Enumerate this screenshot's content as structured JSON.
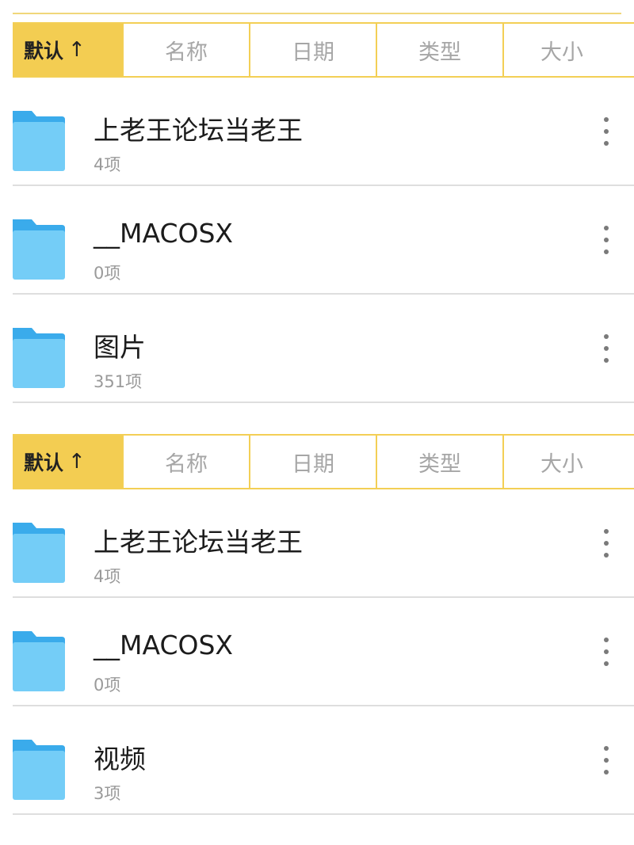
{
  "panels": [
    {
      "sort_tabs": [
        {
          "label": "默认",
          "arrow": "↑",
          "active": true
        },
        {
          "label": "名称"
        },
        {
          "label": "日期"
        },
        {
          "label": "类型"
        },
        {
          "label": "大小"
        }
      ],
      "rows": [
        {
          "name": "上老王论坛当老王",
          "count": "4项"
        },
        {
          "name": "__MACOSX",
          "count": "0项"
        },
        {
          "name": "图片",
          "count": "351项"
        }
      ]
    },
    {
      "sort_tabs": [
        {
          "label": "默认",
          "arrow": "↑",
          "active": true
        },
        {
          "label": "名称"
        },
        {
          "label": "日期"
        },
        {
          "label": "类型"
        },
        {
          "label": "大小"
        }
      ],
      "rows": [
        {
          "name": "上老王论坛当老王",
          "count": "4项"
        },
        {
          "name": "__MACOSX",
          "count": "0项"
        },
        {
          "name": "视频",
          "count": "3项"
        }
      ]
    }
  ],
  "colors": {
    "accent": "#f3cd52",
    "folder_front": "#74cdf7",
    "folder_back": "#3aabeb"
  },
  "icons": {
    "folder": "folder-icon",
    "more": "more-vertical-icon",
    "sort_arrow": "arrow-up-icon"
  }
}
